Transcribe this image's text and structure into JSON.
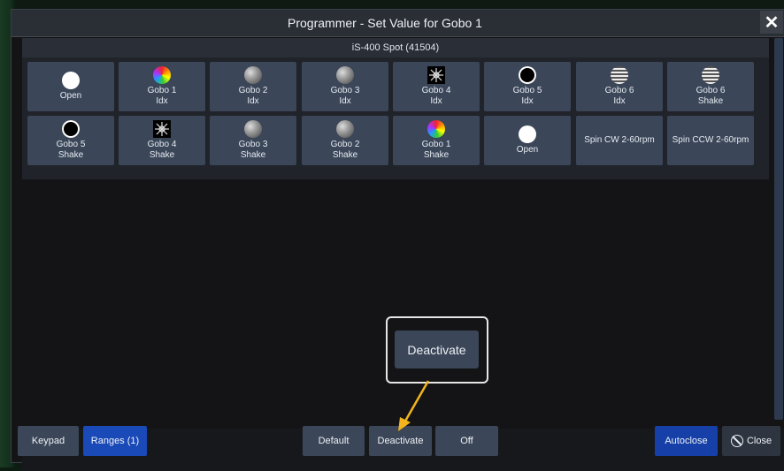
{
  "window": {
    "title": "Programmer - Set Value for Gobo 1",
    "close_glyph": "✕"
  },
  "fixture": {
    "label": "iS-400 Spot (41504)"
  },
  "gobo_grid": {
    "row1": [
      {
        "line1": "Open",
        "line2": "",
        "icon": "open-circle-icon"
      },
      {
        "line1": "Gobo 1",
        "line2": "Idx",
        "icon": "color-wheel-icon"
      },
      {
        "line1": "Gobo 2",
        "line2": "Idx",
        "icon": "texture-gobo-icon"
      },
      {
        "line1": "Gobo 3",
        "line2": "Idx",
        "icon": "texture-gobo-icon"
      },
      {
        "line1": "Gobo 4",
        "line2": "Idx",
        "icon": "star-pattern-icon"
      },
      {
        "line1": "Gobo 5",
        "line2": "Idx",
        "icon": "ring-gobo-icon"
      },
      {
        "line1": "Gobo 6",
        "line2": "Idx",
        "icon": "stripe-gobo-icon"
      },
      {
        "line1": "Gobo 6",
        "line2": "Shake",
        "icon": "stripe-gobo-icon"
      }
    ],
    "row2": [
      {
        "line1": "Gobo 5",
        "line2": "Shake",
        "icon": "ring-gobo-icon"
      },
      {
        "line1": "Gobo 4",
        "line2": "Shake",
        "icon": "star-pattern-icon"
      },
      {
        "line1": "Gobo 3",
        "line2": "Shake",
        "icon": "texture-gobo-icon"
      },
      {
        "line1": "Gobo 2",
        "line2": "Shake",
        "icon": "texture-gobo-icon"
      },
      {
        "line1": "Gobo 1",
        "line2": "Shake",
        "icon": "color-wheel-icon"
      },
      {
        "line1": "Open",
        "line2": "",
        "icon": "open-circle-icon"
      },
      {
        "line1": "Spin CW 2-60rpm",
        "line2": "",
        "icon": ""
      },
      {
        "line1": "Spin CCW 2-60rpm",
        "line2": "",
        "icon": ""
      }
    ]
  },
  "callout": {
    "label": "Deactivate"
  },
  "bottom_bar": {
    "keypad": "Keypad",
    "ranges": "Ranges (1)",
    "default": "Default",
    "deactivate": "Deactivate",
    "off": "Off",
    "autoclose": "Autoclose",
    "close": "Close"
  },
  "colors": {
    "accent_blue": "#1a49b8",
    "button_gray": "#3b4658",
    "arrow_yellow": "#f2b61c"
  }
}
